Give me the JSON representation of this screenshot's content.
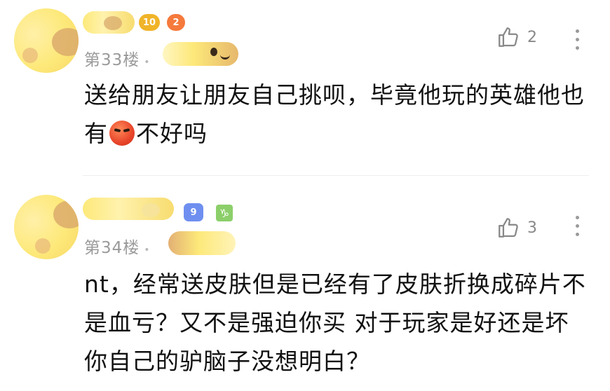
{
  "comments": [
    {
      "level_badge": "10",
      "role_badge": "2",
      "floor": "第33楼",
      "floor_dot": "•",
      "likes": "2",
      "text_line1": "送给朋友让朋友自己挑呗，毕竟他玩的英雄他也",
      "text_line2_pre": "有",
      "emoji_icon": "angry-face-emoji",
      "text_line2_post": "不好吗"
    },
    {
      "level_badge": "9",
      "zodiac_badge": "♑",
      "floor": "第34楼",
      "floor_dot": "•",
      "likes": "3",
      "text_line1": "nt，经常送皮肤但是已经有了皮肤折换成碎片不",
      "text_line2": "是血亏？又不是强迫你买 对于玩家是好还是坏",
      "text_line3": "你自己的驴脑子没想明白？"
    }
  ],
  "colors": {
    "floor_text": "#9a9a9a",
    "like_gray": "#888888",
    "level_badge_gold": "#f0b429",
    "level_badge_blue": "#6f8ff0",
    "zodiac_green": "#8ccf6a"
  }
}
